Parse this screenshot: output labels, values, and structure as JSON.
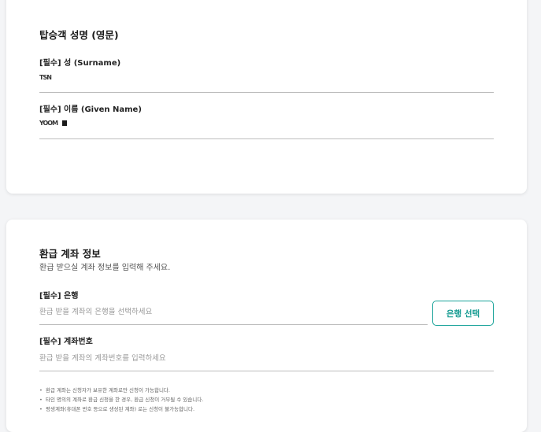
{
  "passenger_name": {
    "title": "탑승객 성명 (영문)",
    "surname": {
      "label": "[필수] 성 (Surname)",
      "value": "TSN"
    },
    "given_name": {
      "label": "[필수] 이름 (Given Name)",
      "value": "YOOM"
    }
  },
  "refund_account": {
    "title": "환급 계좌 정보",
    "subtitle": "환급 받으실 계좌 정보를 입력해 주세요.",
    "bank": {
      "label": "[필수] 은행",
      "placeholder": "환급 받을 계좌의 은행을 선택하세요",
      "button_label": "은행 선택"
    },
    "account_number": {
      "label": "[필수] 계좌번호",
      "placeholder": "환급 받을 계좌의 계좌번호를 입력하세요"
    },
    "notes": [
      "환급 계좌는 신청자가 보유한 계좌로만 신청이 가능합니다.",
      "타인 명의의 계좌로 환급 신청을 한 경우, 환급 신청이 거부될 수 있습니다.",
      "평생계좌(휴대폰 번호 등으로 생성된 계좌) 로는 신청이 불가능합니다."
    ]
  },
  "colors": {
    "accent": "#139a90",
    "background": "#f4f5f7",
    "card": "#ffffff"
  }
}
